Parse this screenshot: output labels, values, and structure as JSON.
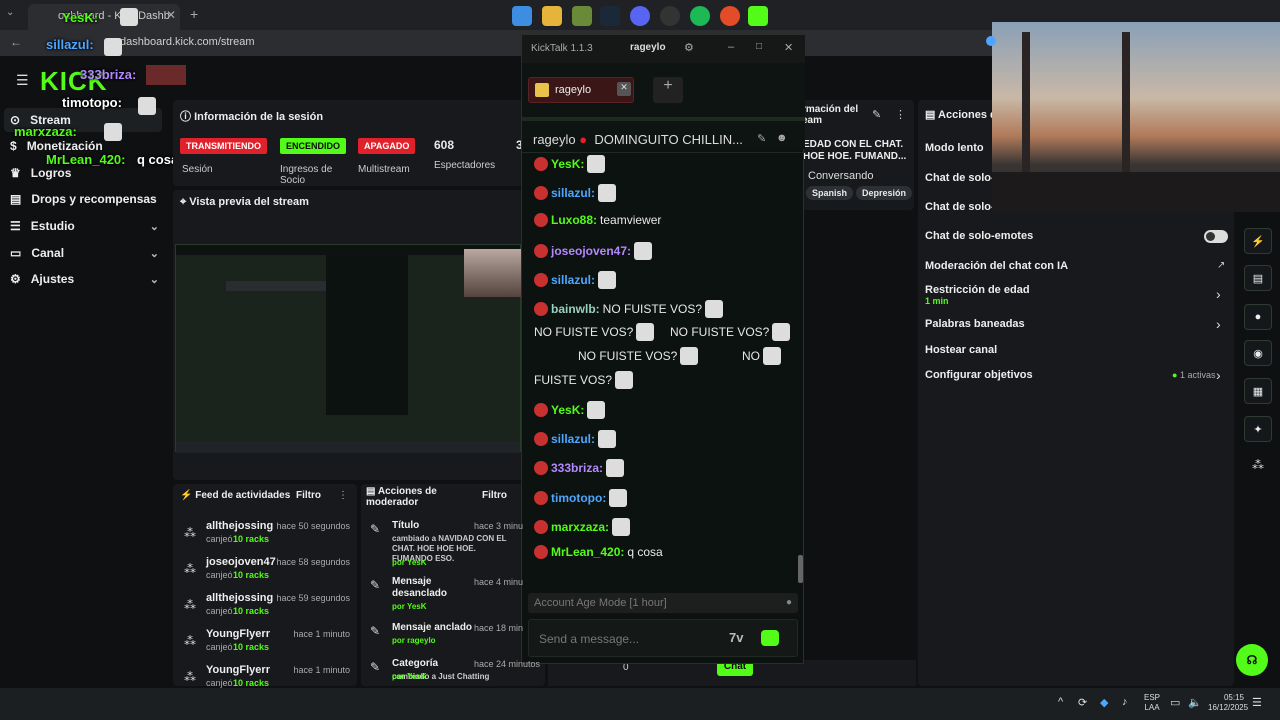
{
  "browser": {
    "tab_title": "oahboard - Kick Dashb",
    "url": "dashboard.kick.com/stream"
  },
  "overlay_chat": [
    {
      "user": "YesK:",
      "color": "#53fc18"
    },
    {
      "user": "sillazul:",
      "color": "#4da6ff"
    },
    {
      "user": "333briza:",
      "color": "#b388ff"
    },
    {
      "user": "timotopo:",
      "color": "#ffffff"
    },
    {
      "user": "marxzaza:",
      "color": "#53fc18"
    },
    {
      "user": "MrLean_420:",
      "color": "#53fc18",
      "text": "q cosa"
    }
  ],
  "logo": "KICK",
  "nav": {
    "stream": "Stream",
    "monetizacion": "Monetización",
    "logros": "Logros",
    "drops": "Drops y recompensas",
    "estudio": "Estudio",
    "canal": "Canal",
    "ajustes": "Ajustes"
  },
  "session": {
    "title": "Información de la sesión",
    "badge_live": "TRANSMITIENDO",
    "badge_on": "ENCENDIDO",
    "badge_off": "APAGADO",
    "viewers": "608",
    "label_session": "Sesión",
    "label_partner": "Ingresos de Socio",
    "label_multistream": "Multistream",
    "label_viewers": "Espectadores",
    "extra": "3"
  },
  "preview": {
    "title": "Vista previa del stream"
  },
  "stream_info": {
    "title": "rmación del eam",
    "desc": "EDAD CON EL CHAT. HOE HOE. FUMAND...",
    "category": "Conversando",
    "tag1": "Spanish",
    "tag2": "Depresión"
  },
  "actions": {
    "title": "Acciones de",
    "slow": "Modo lento",
    "subs1": "Chat de solo-s",
    "subs2": "Chat de solo-s",
    "emotes": "Chat de solo-emotes",
    "ai_mod": "Moderación del chat con IA",
    "age": "Restricción de edad",
    "age_val": "1 min",
    "banned": "Palabras baneadas",
    "host": "Hostear canal",
    "goals": "Configurar objetivos",
    "goals_val": "1 activas"
  },
  "feed": {
    "title": "Feed de actividades",
    "filter": "Filtro",
    "items": [
      {
        "user": "allthejossing",
        "time": "hace 50 segundos",
        "action": "canjeó",
        "reward": "10 racks"
      },
      {
        "user": "joseojoven47",
        "time": "hace 58 segundos",
        "action": "canjeó",
        "reward": "10 racks"
      },
      {
        "user": "allthejossing",
        "time": "hace 59 segundos",
        "action": "canjeó",
        "reward": "10 racks"
      },
      {
        "user": "YoungFlyerr",
        "time": "hace 1 minuto",
        "action": "canjeó",
        "reward": "10 racks"
      },
      {
        "user": "YoungFlyerr",
        "time": "hace 1 minuto",
        "action": "canjeó",
        "reward": "10 racks"
      }
    ]
  },
  "modactions": {
    "title": "Acciones de moderador",
    "filter": "Filtro",
    "items": [
      {
        "title": "Título",
        "time": "hace 3 minu",
        "detail": "cambiado a NAVIDAD CON EL CHAT. HOE HOE HOE. FUMANDO ESO.",
        "by": "por YesK"
      },
      {
        "title": "Mensaje desanclado",
        "time": "hace 4 minu",
        "detail": "",
        "by": "por YesK"
      },
      {
        "title": "Mensaje anclado",
        "time": "hace 18 min",
        "detail": "",
        "by": "por rageylo"
      },
      {
        "title": "Categoría",
        "time": "hace 24 minutos",
        "detail": "cambiado a Just Chatting",
        "by": "por YesK"
      }
    ]
  },
  "bottom_bar": {
    "chat_button": "Chat",
    "count": "0"
  },
  "kicktalk": {
    "title": "KickTalk 1.1.3",
    "user": "rageylo",
    "tab_label": "rageylo",
    "channel": "rageylo",
    "stream_title": "DOMINGUITO CHILLIN...",
    "messages": [
      {
        "user": "YesK:",
        "color": "#53fc18",
        "text": ""
      },
      {
        "user": "sillazul:",
        "color": "#4da6ff",
        "text": ""
      },
      {
        "user": "Luxo88:",
        "color": "#53fc18",
        "text": "teamviewer"
      },
      {
        "user": "joseojoven47:",
        "color": "#b388ff",
        "text": ""
      },
      {
        "user": "sillazul:",
        "color": "#4da6ff",
        "text": ""
      },
      {
        "user": "bainwlb:",
        "color": "#9ad0c0",
        "text": "NO FUISTE VOS?"
      },
      {
        "user": "",
        "color": "",
        "text": "NO FUISTE VOS?"
      },
      {
        "user": "",
        "color": "",
        "text": "NO FUISTE VOS?"
      },
      {
        "user": "",
        "color": "",
        "text": "NO FUISTE VOS?"
      },
      {
        "user": "",
        "color": "",
        "text": "NO"
      },
      {
        "user": "",
        "color": "",
        "text": "FUISTE VOS?"
      },
      {
        "user": "YesK:",
        "color": "#53fc18",
        "text": ""
      },
      {
        "user": "sillazul:",
        "color": "#4da6ff",
        "text": ""
      },
      {
        "user": "333briza:",
        "color": "#b388ff",
        "text": ""
      },
      {
        "user": "timotopo:",
        "color": "#4da6ff",
        "text": ""
      },
      {
        "user": "marxzaza:",
        "color": "#53fc18",
        "text": ""
      },
      {
        "user": "MrLean_420:",
        "color": "#53fc18",
        "text": "q cosa"
      }
    ],
    "mode_placeholder": "Account Age Mode [1 hour]",
    "input_placeholder": "Send a message..."
  },
  "taskbar": {
    "lang": "ESP",
    "region": "LAA",
    "time": "05:15",
    "date": "16/12/2025"
  }
}
